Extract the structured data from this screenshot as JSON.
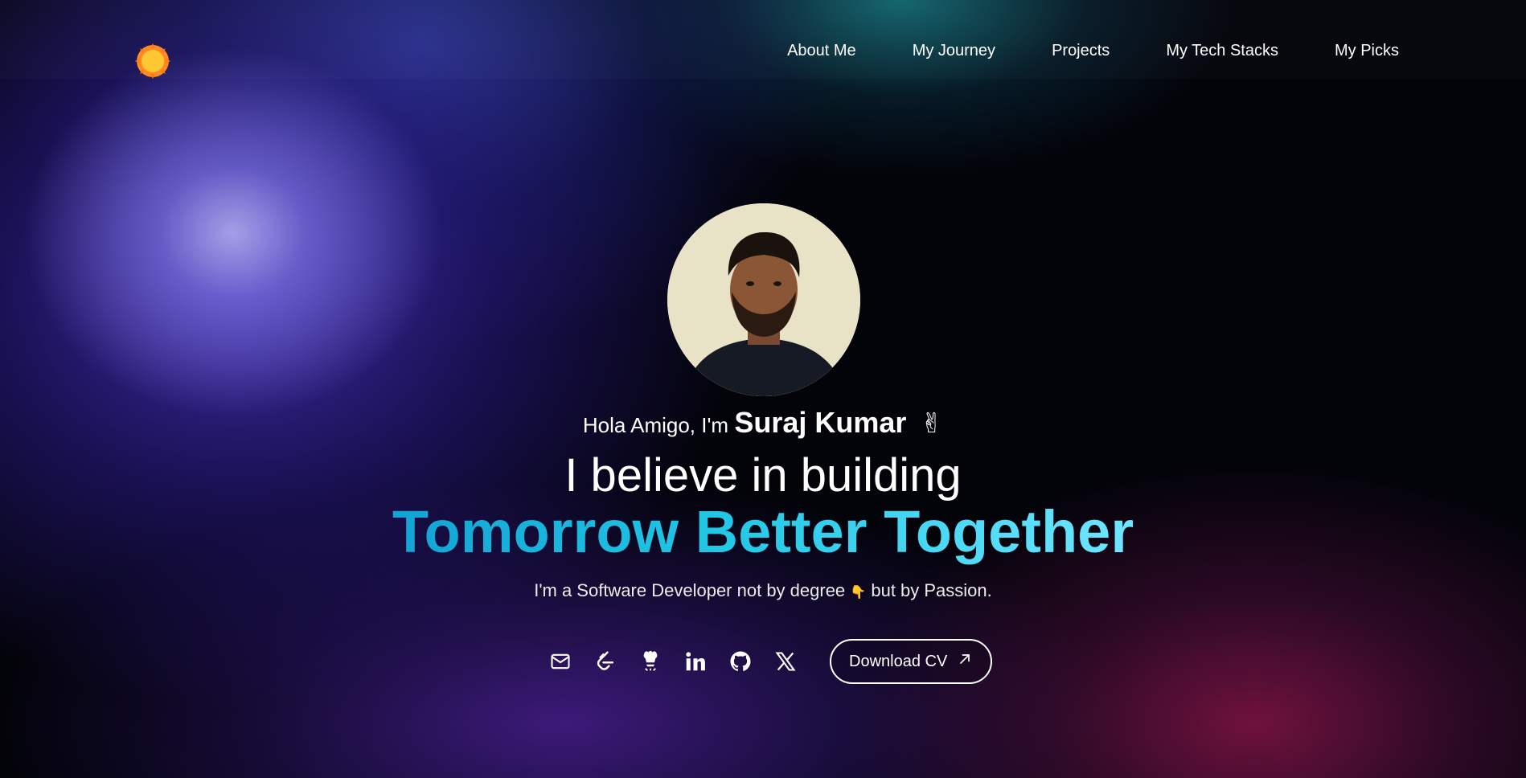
{
  "nav": {
    "logo_icon": "sun-icon",
    "items": [
      {
        "label": "About Me"
      },
      {
        "label": "My Journey"
      },
      {
        "label": "Projects"
      },
      {
        "label": "My Tech Stacks"
      },
      {
        "label": "My Picks"
      }
    ]
  },
  "hero": {
    "greeting_prefix": "Hola Amigo, I'm",
    "name": "Suraj Kumar",
    "wave": "✌",
    "headline_line1": "I believe in building",
    "headline_line2": "Tomorrow Better Together",
    "tagline_part1": "I'm a Software Developer not by degree",
    "tagline_emoji": "👇",
    "tagline_part2": "but by Passion."
  },
  "socials": [
    {
      "icon": "mail-icon"
    },
    {
      "icon": "leetcode-icon"
    },
    {
      "icon": "codechef-icon"
    },
    {
      "icon": "linkedin-icon"
    },
    {
      "icon": "github-icon"
    },
    {
      "icon": "x-icon"
    }
  ],
  "cta": {
    "label": "Download CV",
    "icon": "arrow-up-right-icon"
  },
  "colors": {
    "accent_start": "#12a3d3",
    "accent_end": "#6fe6ff",
    "logo": "#ffb020"
  }
}
